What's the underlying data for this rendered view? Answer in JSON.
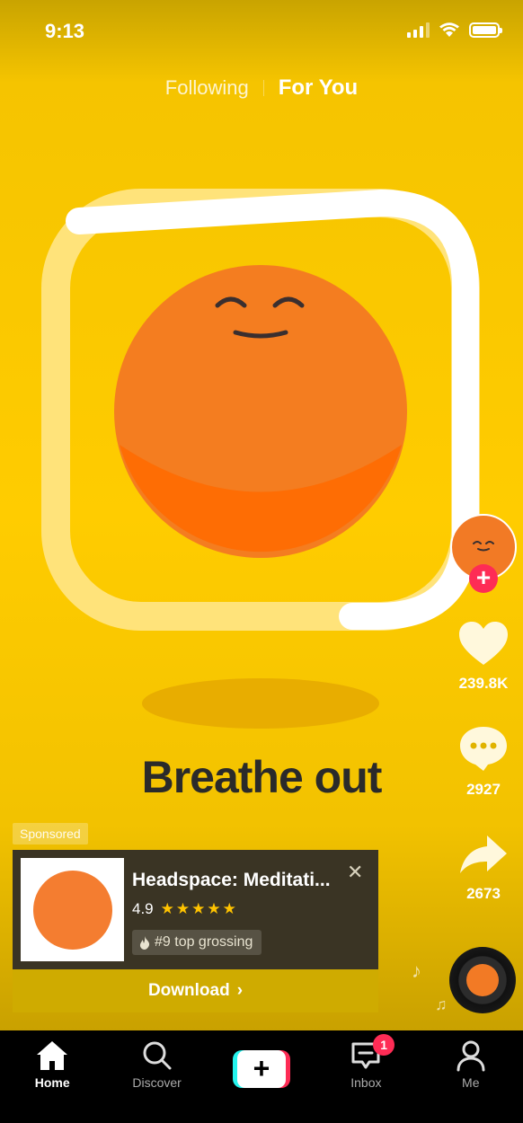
{
  "status": {
    "time": "9:13"
  },
  "tabs": {
    "following": "Following",
    "for_you": "For You"
  },
  "video": {
    "caption": "Breathe out"
  },
  "actions": {
    "likes": "239.8K",
    "comments": "2927",
    "shares": "2673"
  },
  "ad": {
    "sponsored_label": "Sponsored",
    "title": "Headspace: Meditati...",
    "rating": "4.9",
    "stars": "★★★★★",
    "rank": "#9 top grossing",
    "download_label": "Download"
  },
  "nav": {
    "home": "Home",
    "discover": "Discover",
    "create": "+",
    "inbox": "Inbox",
    "inbox_badge": "1",
    "me": "Me"
  },
  "colors": {
    "background_yellow": "#ffcc00",
    "orb_orange": "#f47d30",
    "accent_red": "#fe2c55",
    "accent_cyan": "#25f4ee",
    "download_gold": "#cfab00"
  }
}
